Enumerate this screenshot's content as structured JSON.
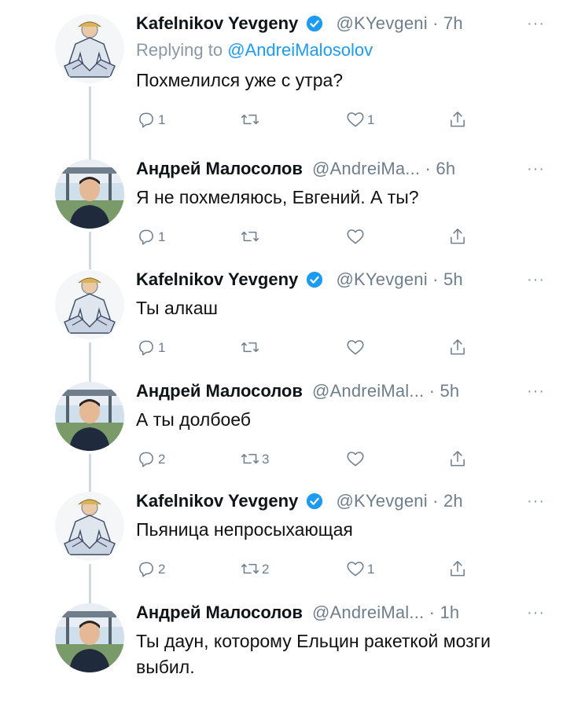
{
  "colors": {
    "name": "#0f1419",
    "meta": "#6e7e8c",
    "link": "#1d9bf0",
    "verified": "#1d9bf0",
    "thread_line": "#cfd9de",
    "icon": "#6e7e8c"
  },
  "tweets": [
    {
      "avatar": "avatar-kafelnikov",
      "name": "Kafelnikov Yevgeny",
      "verified": true,
      "meta": "@KYevgeni · 7h",
      "replying_prefix": "Replying to ",
      "replying_to": "@AndreiMalosolov",
      "text": "Похмелился уже с утра?",
      "reply_count": "1",
      "retweet_count": "",
      "like_count": "1"
    },
    {
      "avatar": "avatar-malosolov",
      "name": "Андрей Малосолов",
      "verified": false,
      "meta": "@AndreiMa... · 6h",
      "text": "Я не похмеляюсь, Евгений. А ты?",
      "reply_count": "1",
      "retweet_count": "",
      "like_count": ""
    },
    {
      "avatar": "avatar-kafelnikov",
      "name": "Kafelnikov Yevgeny",
      "verified": true,
      "meta": "@KYevgeni · 5h",
      "text": "Ты алкаш",
      "reply_count": "1",
      "retweet_count": "",
      "like_count": ""
    },
    {
      "avatar": "avatar-malosolov",
      "name": "Андрей Малосолов",
      "verified": false,
      "meta": "@AndreiMal... · 5h",
      "text": "А ты долбоеб",
      "reply_count": "2",
      "retweet_count": "3",
      "like_count": ""
    },
    {
      "avatar": "avatar-kafelnikov",
      "name": "Kafelnikov Yevgeny",
      "verified": true,
      "meta": "@KYevgeni · 2h",
      "text": "Пьяница непросыхающая",
      "reply_count": "2",
      "retweet_count": "2",
      "like_count": "1"
    },
    {
      "avatar": "avatar-malosolov",
      "name": "Андрей Малосолов",
      "verified": false,
      "meta": "@AndreiMal... · 1h",
      "text": "Ты даун, которому Ельцин ракеткой мозги выбил.",
      "reply_count": "",
      "retweet_count": "",
      "like_count": ""
    }
  ],
  "more_glyph": "···",
  "icons": {
    "reply": "reply-icon",
    "retweet": "retweet-icon",
    "like": "heart-icon",
    "share": "share-icon",
    "verified": "verified-badge-icon"
  }
}
